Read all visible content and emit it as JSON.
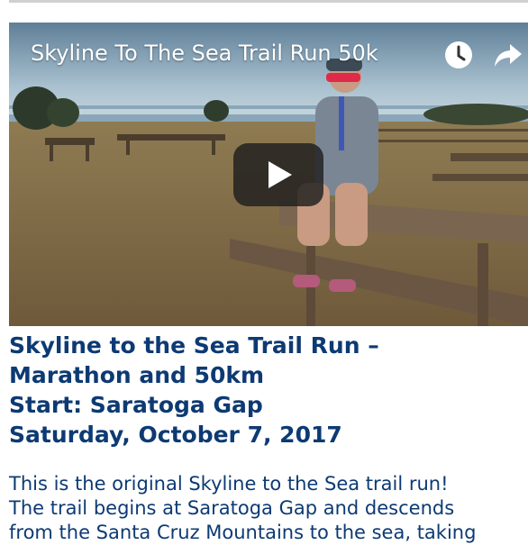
{
  "video": {
    "title": "Skyline To The Sea Trail Run 50k",
    "icons": {
      "watch_later": "clock-icon",
      "share": "share-arrow-icon",
      "play": "play-icon"
    }
  },
  "heading": {
    "lines": [
      "Skyline to the Sea Trail Run –",
      "Marathon and 50km",
      "Start: Saratoga Gap",
      "Saturday, October 7, 2017"
    ]
  },
  "body": {
    "lines": [
      "This is the original Skyline to the Sea trail run!",
      "The trail begins at Saratoga Gap and descends",
      "from the Santa Cruz Mountains to the sea, taking"
    ]
  },
  "colors": {
    "heading": "#0d3a73",
    "body": "#0d3a73"
  }
}
